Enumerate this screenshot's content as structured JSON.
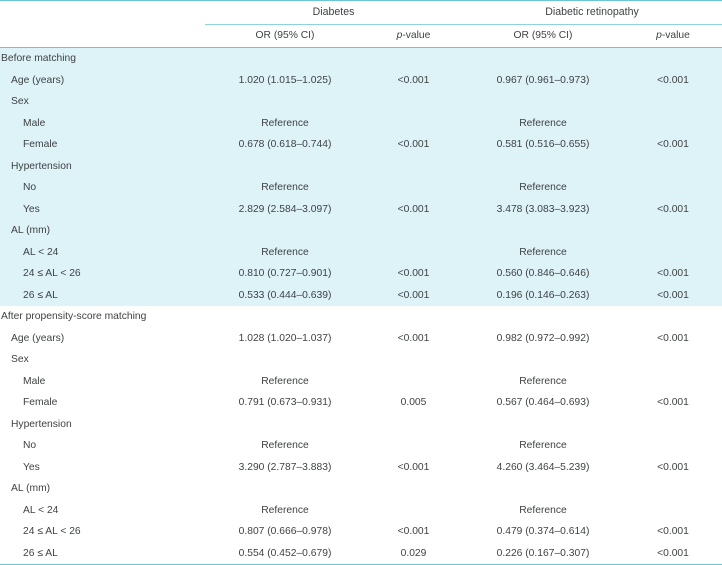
{
  "table": {
    "column_groups": [
      {
        "label": "",
        "span": 1
      },
      {
        "label": "Diabetes",
        "span": 2
      },
      {
        "label": "Diabetic retinopathy",
        "span": 2
      }
    ],
    "column_headers": [
      "",
      "OR (95% CI)",
      "p-value",
      "OR (95% CI)",
      "p-value"
    ],
    "p_value_prefix": "p",
    "p_value_suffix": "-value",
    "colors": {
      "rule": "#6cc5d4",
      "group_rule": "#8fd2dd",
      "shaded_row_bg": "#ddf3f8",
      "text": "#3f4244",
      "page_bg": "#ffffff"
    },
    "sections": [
      {
        "name": "before-matching",
        "shaded": true,
        "rows": [
          {
            "label": "Before matching",
            "indent": 0,
            "or1": "",
            "p1": "",
            "or2": "",
            "p2": ""
          },
          {
            "label": "Age (years)",
            "indent": 1,
            "or1": "1.020 (1.015–1.025)",
            "p1": "<0.001",
            "or2": "0.967 (0.961–0.973)",
            "p2": "<0.001"
          },
          {
            "label": "Sex",
            "indent": 1,
            "or1": "",
            "p1": "",
            "or2": "",
            "p2": ""
          },
          {
            "label": "Male",
            "indent": 2,
            "or1": "Reference",
            "p1": "",
            "or2": "Reference",
            "p2": ""
          },
          {
            "label": "Female",
            "indent": 2,
            "or1": "0.678 (0.618–0.744)",
            "p1": "<0.001",
            "or2": "0.581 (0.516–0.655)",
            "p2": "<0.001"
          },
          {
            "label": "Hypertension",
            "indent": 1,
            "or1": "",
            "p1": "",
            "or2": "",
            "p2": ""
          },
          {
            "label": "No",
            "indent": 2,
            "or1": "Reference",
            "p1": "",
            "or2": "Reference",
            "p2": ""
          },
          {
            "label": "Yes",
            "indent": 2,
            "or1": "2.829 (2.584–3.097)",
            "p1": "<0.001",
            "or2": "3.478 (3.083–3.923)",
            "p2": "<0.001"
          },
          {
            "label": "AL (mm)",
            "indent": 1,
            "or1": "",
            "p1": "",
            "or2": "",
            "p2": ""
          },
          {
            "label": "AL < 24",
            "indent": 2,
            "or1": "Reference",
            "p1": "",
            "or2": "Reference",
            "p2": ""
          },
          {
            "label": "24 ≤ AL < 26",
            "indent": 2,
            "or1": "0.810 (0.727–0.901)",
            "p1": "<0.001",
            "or2": "0.560 (0.846–0.646)",
            "p2": "<0.001"
          },
          {
            "label": "26 ≤ AL",
            "indent": 2,
            "or1": "0.533 (0.444–0.639)",
            "p1": "<0.001",
            "or2": "0.196 (0.146–0.263)",
            "p2": "<0.001"
          }
        ]
      },
      {
        "name": "after-propensity-score-matching",
        "shaded": false,
        "rows": [
          {
            "label": "After propensity-score matching",
            "indent": 0,
            "or1": "",
            "p1": "",
            "or2": "",
            "p2": ""
          },
          {
            "label": "Age (years)",
            "indent": 1,
            "or1": "1.028 (1.020–1.037)",
            "p1": "<0.001",
            "or2": "0.982 (0.972–0.992)",
            "p2": "<0.001"
          },
          {
            "label": "Sex",
            "indent": 1,
            "or1": "",
            "p1": "",
            "or2": "",
            "p2": ""
          },
          {
            "label": "Male",
            "indent": 2,
            "or1": "Reference",
            "p1": "",
            "or2": "Reference",
            "p2": ""
          },
          {
            "label": "Female",
            "indent": 2,
            "or1": "0.791 (0.673–0.931)",
            "p1": "0.005",
            "or2": "0.567 (0.464–0.693)",
            "p2": "<0.001"
          },
          {
            "label": "Hypertension",
            "indent": 1,
            "or1": "",
            "p1": "",
            "or2": "",
            "p2": ""
          },
          {
            "label": "No",
            "indent": 2,
            "or1": "Reference",
            "p1": "",
            "or2": "Reference",
            "p2": ""
          },
          {
            "label": "Yes",
            "indent": 2,
            "or1": "3.290 (2.787–3.883)",
            "p1": "<0.001",
            "or2": "4.260 (3.464–5.239)",
            "p2": "<0.001"
          },
          {
            "label": "AL (mm)",
            "indent": 1,
            "or1": "",
            "p1": "",
            "or2": "",
            "p2": ""
          },
          {
            "label": "AL < 24",
            "indent": 2,
            "or1": "Reference",
            "p1": "",
            "or2": "Reference",
            "p2": ""
          },
          {
            "label": "24 ≤ AL < 26",
            "indent": 2,
            "or1": "0.807 (0.666–0.978)",
            "p1": "<0.001",
            "or2": "0.479 (0.374–0.614)",
            "p2": "<0.001"
          },
          {
            "label": "26 ≤ AL",
            "indent": 2,
            "or1": "0.554 (0.452–0.679)",
            "p1": "0.029",
            "or2": "0.226 (0.167–0.307)",
            "p2": "<0.001"
          }
        ]
      }
    ]
  }
}
